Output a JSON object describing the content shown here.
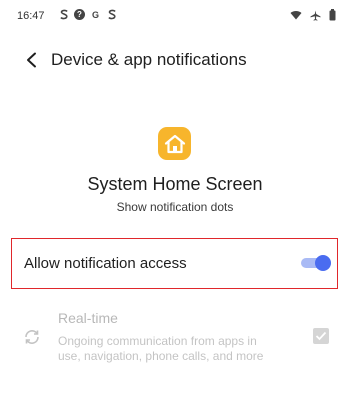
{
  "status_bar": {
    "time": "16:47",
    "left_icons": [
      "s-icon",
      "help-icon",
      "google-icon",
      "s-icon"
    ],
    "right_icons": [
      "wifi-icon",
      "airplane-icon",
      "battery-icon"
    ]
  },
  "header": {
    "title": "Device & app notifications"
  },
  "app": {
    "icon": "home-icon",
    "icon_color": "#f7b52c",
    "name": "System Home Screen",
    "subtitle": "Show notification dots"
  },
  "allow_access": {
    "label": "Allow notification access",
    "enabled": true,
    "accent": "#4a6cf0",
    "highlight_color": "#e0272b"
  },
  "realtime": {
    "title": "Real-time",
    "description": "Ongoing communication from apps in use, navigation, phone calls, and more",
    "checked": true,
    "disabled": true
  }
}
